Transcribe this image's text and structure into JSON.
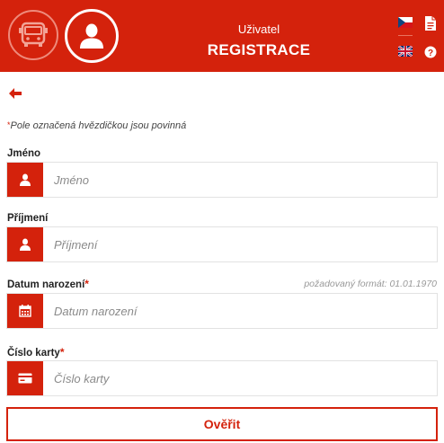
{
  "header": {
    "title": "Uživatel",
    "subtitle": "REGISTRACE",
    "bus_icon": "bus-icon",
    "user_icon": "user-icon",
    "languages": [
      "cs",
      "en"
    ],
    "doc_icon": "document-icon",
    "help_icon": "help-icon"
  },
  "form": {
    "required_note": "Pole označená hvězdičkou jsou povinná",
    "required_mark": "*",
    "first_name": {
      "label": "Jméno",
      "placeholder": "Jméno",
      "value": ""
    },
    "last_name": {
      "label": "Příjmení",
      "placeholder": "Příjmení",
      "value": ""
    },
    "birth_date": {
      "label": "Datum narození",
      "placeholder": "Datum narození",
      "hint": "požadovaný formát: 01.01.1970",
      "value": ""
    },
    "card_number": {
      "label": "Číslo karty",
      "placeholder": "Číslo karty",
      "value": ""
    },
    "submit_label": "Ověřit"
  },
  "colors": {
    "accent": "#d4220c"
  }
}
